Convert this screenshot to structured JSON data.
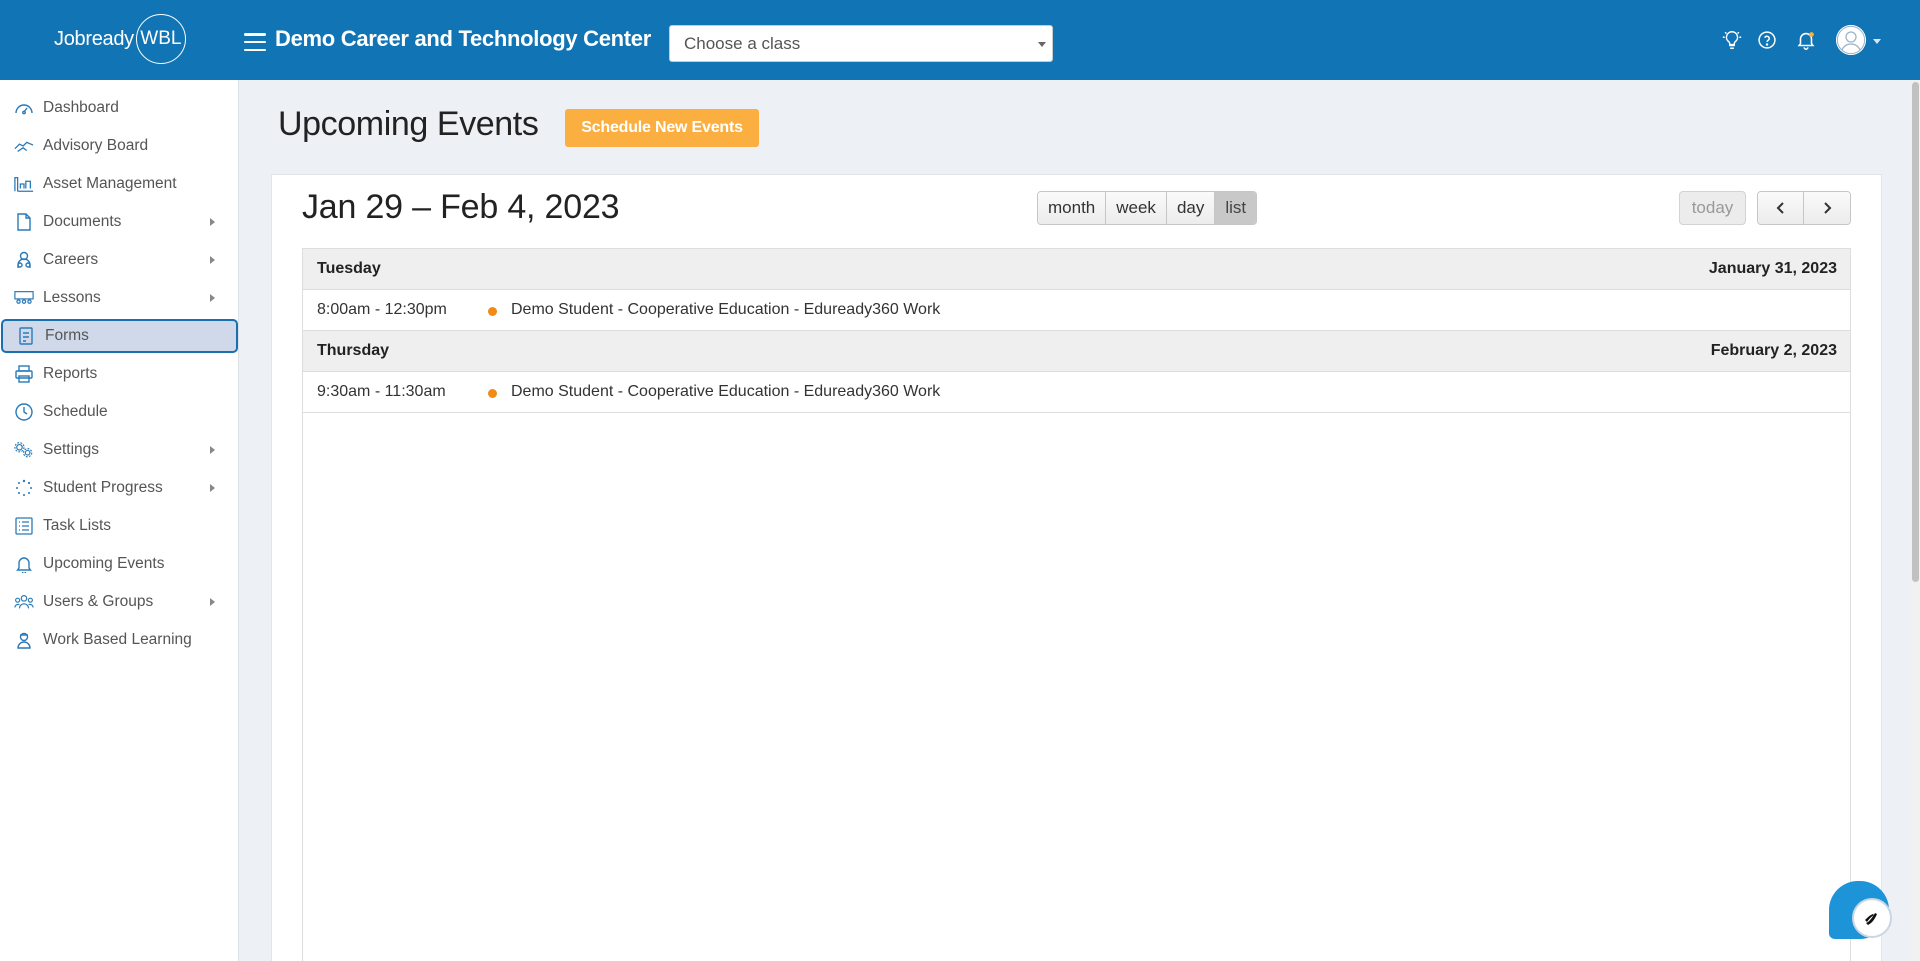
{
  "header": {
    "logo_text": "Jobready",
    "logo_badge": "WBL",
    "org_title": "Demo Career and Technology Center",
    "class_select_placeholder": "Choose a class",
    "icons": [
      "lightbulb-icon",
      "help-icon",
      "bell-icon",
      "user-avatar-icon"
    ],
    "bg_color": "#1174b4"
  },
  "sidebar": {
    "items": [
      {
        "label": "Dashboard",
        "icon": "dashboard-icon",
        "has_submenu": false
      },
      {
        "label": "Advisory Board",
        "icon": "handshake-icon",
        "has_submenu": false
      },
      {
        "label": "Asset Management",
        "icon": "warehouse-icon",
        "has_submenu": false
      },
      {
        "label": "Documents",
        "icon": "document-icon",
        "has_submenu": true
      },
      {
        "label": "Careers",
        "icon": "careers-icon",
        "has_submenu": true
      },
      {
        "label": "Lessons",
        "icon": "lessons-icon",
        "has_submenu": true
      },
      {
        "label": "Forms",
        "icon": "form-icon",
        "has_submenu": false,
        "active": true
      },
      {
        "label": "Reports",
        "icon": "printer-icon",
        "has_submenu": false
      },
      {
        "label": "Schedule",
        "icon": "clock-icon",
        "has_submenu": false
      },
      {
        "label": "Settings",
        "icon": "gears-icon",
        "has_submenu": true
      },
      {
        "label": "Student Progress",
        "icon": "spinner-icon",
        "has_submenu": true
      },
      {
        "label": "Task Lists",
        "icon": "list-icon",
        "has_submenu": false
      },
      {
        "label": "Upcoming Events",
        "icon": "bell-icon",
        "has_submenu": false
      },
      {
        "label": "Users & Groups",
        "icon": "users-icon",
        "has_submenu": true
      },
      {
        "label": "Work Based Learning",
        "icon": "worker-icon",
        "has_submenu": false
      }
    ]
  },
  "main": {
    "title": "Upcoming Events",
    "schedule_button": "Schedule New Events",
    "accent_color": "#fbaf40",
    "calendar": {
      "range": "Jan 29 – Feb 4, 2023",
      "views": [
        "month",
        "week",
        "day",
        "list"
      ],
      "active_view": "list",
      "today_label": "today",
      "days": [
        {
          "name": "Tuesday",
          "date": "January 31, 2023",
          "events": [
            {
              "time": "8:00am - 12:30pm",
              "title": "Demo Student - Cooperative Education - Eduready360 Work"
            }
          ]
        },
        {
          "name": "Thursday",
          "date": "February 2, 2023",
          "events": [
            {
              "time": "9:30am - 11:30am",
              "title": "Demo Student - Cooperative Education - Eduready360 Work"
            }
          ]
        }
      ],
      "event_dot_color": "#f18b14"
    }
  }
}
